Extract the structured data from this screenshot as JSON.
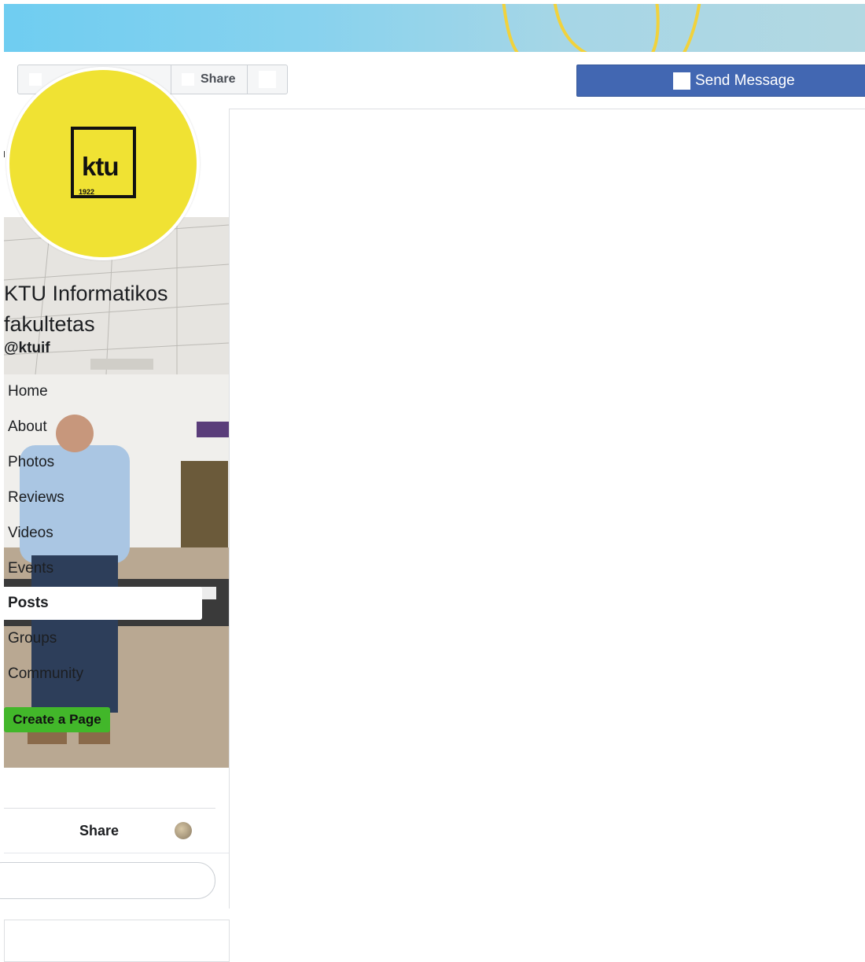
{
  "page": {
    "name": "KTU Informatikos fakultetas",
    "handle": "@ktuif"
  },
  "logo": {
    "text": "ktu",
    "year": "1922"
  },
  "action_bar": {
    "share_label": "Share",
    "send_message_label": "Send Message"
  },
  "nav": {
    "items": [
      {
        "label": "Home",
        "active": false
      },
      {
        "label": "About",
        "active": false
      },
      {
        "label": "Photos",
        "active": false
      },
      {
        "label": "Reviews",
        "active": false
      },
      {
        "label": "Videos",
        "active": false
      },
      {
        "label": "Events",
        "active": false
      },
      {
        "label": "Posts",
        "active": true
      },
      {
        "label": "Groups",
        "active": false
      },
      {
        "label": "Community",
        "active": false
      }
    ]
  },
  "create_page_label": "Create a Page",
  "post_actions": {
    "share_label": "Share"
  },
  "colors": {
    "primary_blue": "#4267b2",
    "create_green": "#42b72a",
    "logo_yellow": "#f0e233"
  }
}
